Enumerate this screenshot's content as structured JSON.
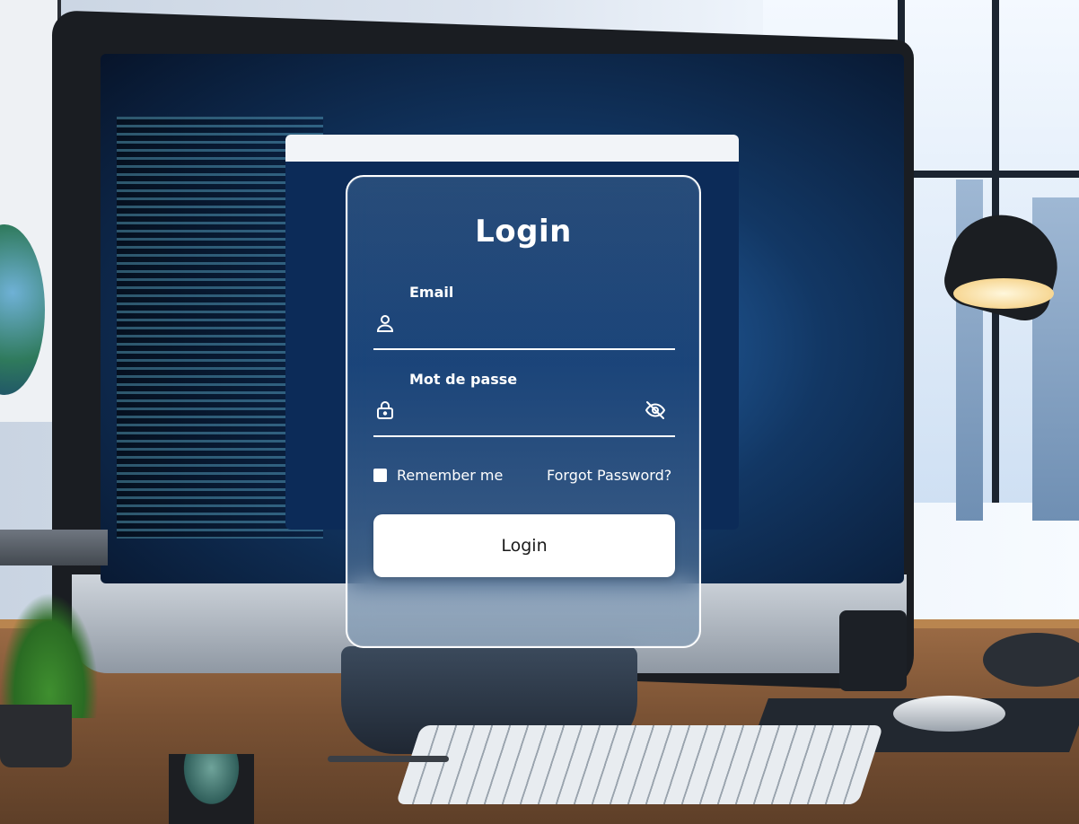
{
  "login": {
    "title": "Login",
    "email": {
      "label": "Email",
      "value": "",
      "placeholder": "",
      "icon": "user-icon"
    },
    "password": {
      "label": "Mot de passe",
      "value": "",
      "placeholder": "",
      "icon": "lock-icon",
      "toggle_icon": "eye-slash-icon"
    },
    "remember_label": "Remember me",
    "remember_checked": false,
    "forgot_label": "Forgot Password?",
    "submit_label": "Login"
  },
  "colors": {
    "text": "#ffffff",
    "button_bg": "#ffffff",
    "button_text": "#1a1a1a"
  }
}
